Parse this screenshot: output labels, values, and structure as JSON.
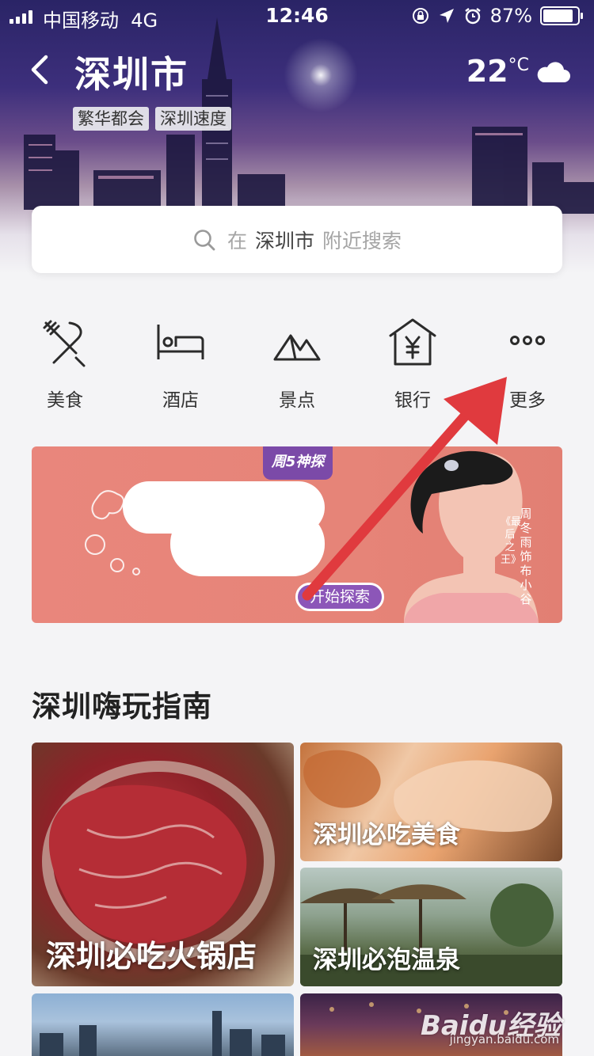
{
  "status_bar": {
    "carrier": "中国移动",
    "network": "4G",
    "time": "12:46",
    "battery": "87%",
    "battery_level": 0.87
  },
  "header": {
    "city": "深圳市",
    "tags": [
      "繁华都会",
      "深圳速度"
    ],
    "temperature": "22",
    "temp_unit": "°C",
    "weather_icon": "cloud-icon"
  },
  "search": {
    "prefix": "在",
    "city": "深圳市",
    "suffix": "附近搜索"
  },
  "categories": [
    {
      "label": "美食",
      "icon": "fork-knife-icon"
    },
    {
      "label": "酒店",
      "icon": "bed-icon"
    },
    {
      "label": "景点",
      "icon": "mountain-icon"
    },
    {
      "label": "银行",
      "icon": "bank-icon"
    },
    {
      "label": "更多",
      "icon": "more-dots-icon"
    }
  ],
  "banner": {
    "badge": "周5神探",
    "cta": "开始探索",
    "vertical_text": "周冬雨 饰 布小谷",
    "vertical_text_2": "《最后之王》"
  },
  "guide": {
    "title": "深圳嗨玩指南",
    "tiles": [
      {
        "caption": "深圳必吃火锅店"
      },
      {
        "caption": "深圳必吃美食"
      },
      {
        "caption": "深圳必泡温泉"
      }
    ]
  },
  "watermark": {
    "brand": "Baidu经验",
    "url": "jingyan.baidu.com"
  },
  "colors": {
    "arrow": "#e03a3e",
    "banner_bg": "#e8867b",
    "banner_purple": "#7b4aa8"
  }
}
